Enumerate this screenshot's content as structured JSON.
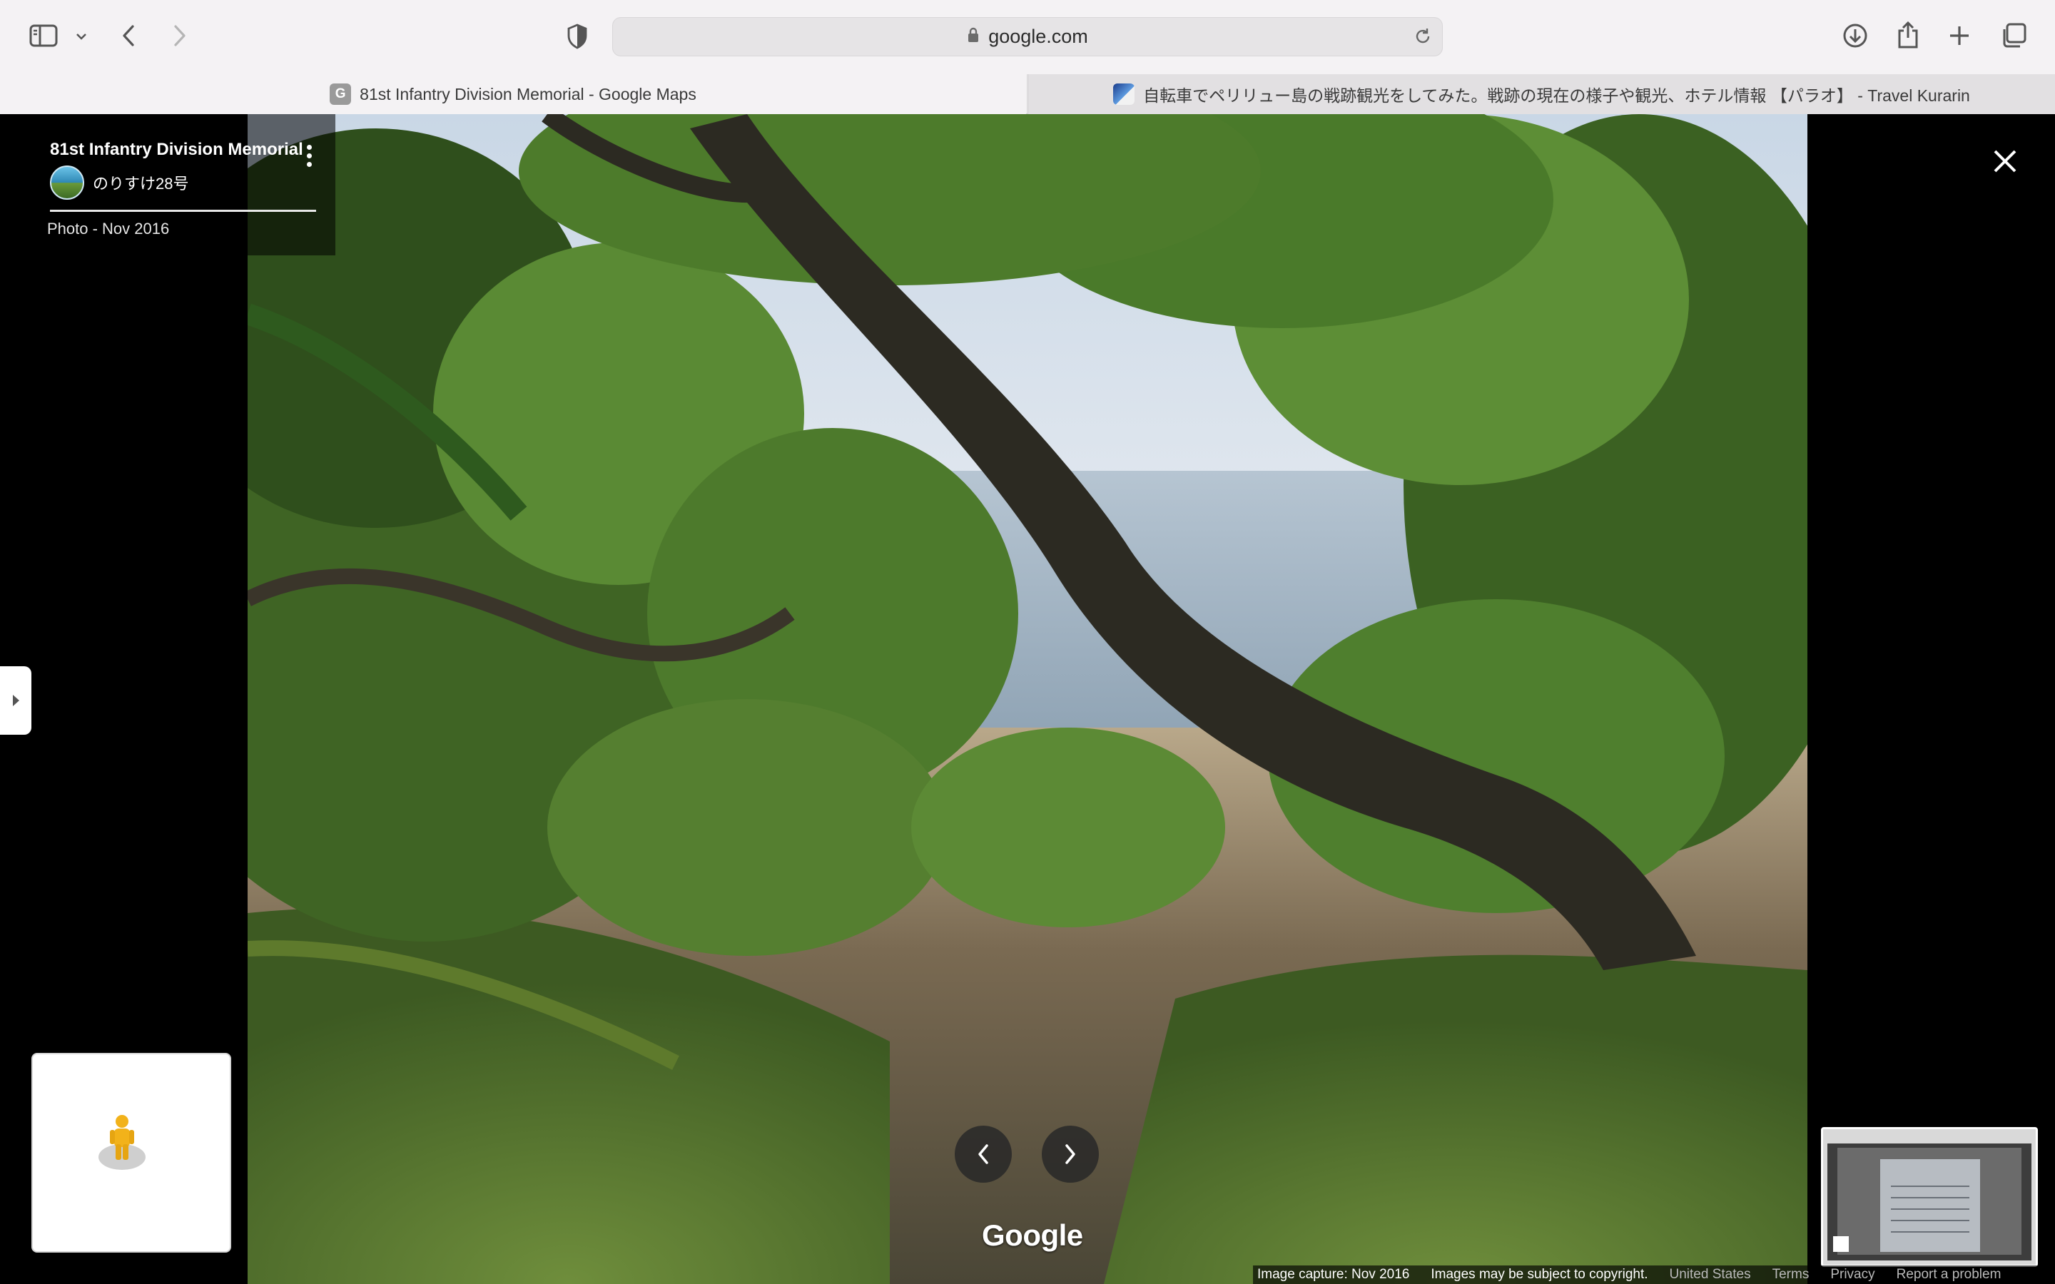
{
  "browser": {
    "url": "google.com",
    "tabs": [
      {
        "favicon": "G",
        "title": "81st Infantry Division Memorial - Google Maps",
        "active": true
      },
      {
        "favicon": "travel-kurarin-favicon",
        "title": "自転車でペリリュー島の戦跡観光をしてみた。戦跡の現在の様子や観光、ホテル情報 【パラオ】 - Travel Kurarin",
        "active": false
      }
    ],
    "icons": {
      "sidebar": "sidebar-icon",
      "back": "chevron-left-icon",
      "forward": "chevron-right-icon",
      "privacy": "shield-icon",
      "lock": "lock-icon",
      "reload": "reload-icon",
      "downloads": "download-icon",
      "share": "share-icon",
      "new_tab": "plus-icon",
      "tab_overview": "tabs-overview-icon"
    }
  },
  "photo_viewer": {
    "place_title": "81st Infantry Division Memorial",
    "author": "のりすけ28号",
    "photo_date": "Photo - Nov 2016",
    "brand": "Google",
    "footer": {
      "capture": "Image capture: Nov 2016",
      "copyright": "Images may be subject to copyright.",
      "region": "United States",
      "terms": "Terms",
      "privacy": "Privacy",
      "report": "Report a problem"
    },
    "colors": {
      "panel_bg": "#000000",
      "nav_button": "#282828",
      "foliage": "#4e7a2c",
      "sea": "#9fb4c4"
    }
  }
}
